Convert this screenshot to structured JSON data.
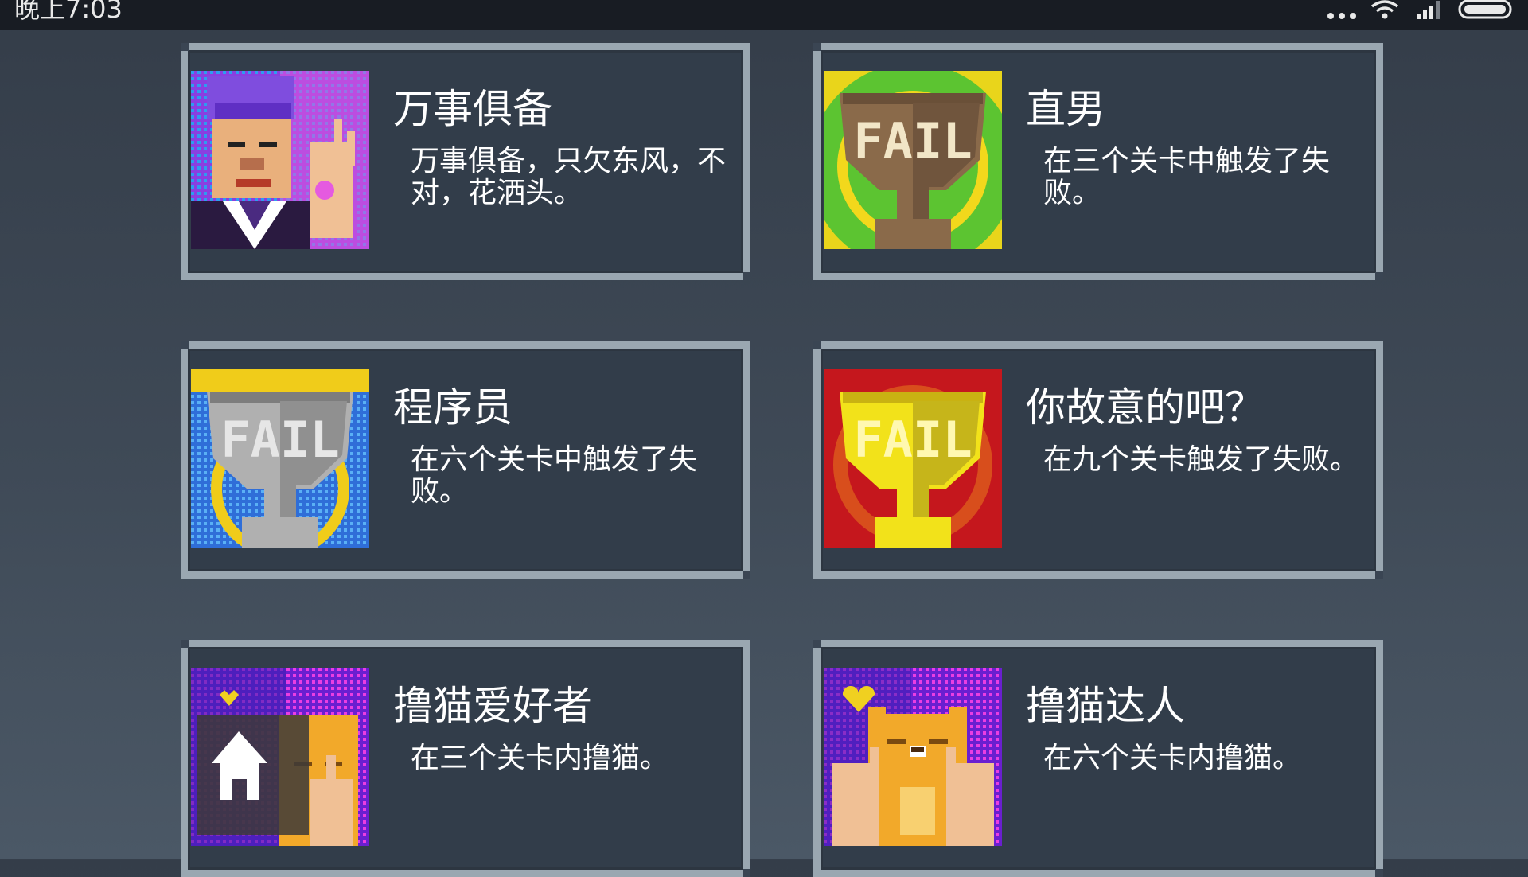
{
  "status_bar": {
    "time": "晚上7:03",
    "icons": [
      "more-dots-icon",
      "wifi-icon",
      "signal-icon",
      "battery-icon"
    ]
  },
  "achievements": [
    {
      "title": "万事俱备",
      "description": "万事俱备，只欠东风，不对，花洒头。",
      "image": "old-man-ok-gesture"
    },
    {
      "title": "直男",
      "description": "在三个关卡中触发了失败。",
      "image": "fail-trophy-bronze"
    },
    {
      "title": "程序员",
      "description": "在六个关卡中触发了失败。",
      "image": "fail-trophy-silver"
    },
    {
      "title": "你故意的吧？",
      "description": "在九个关卡触发了失败。",
      "image": "fail-trophy-gold"
    },
    {
      "title": "撸猫爱好者",
      "description": "在三个关卡内撸猫。",
      "image": "cat-petting-paw"
    },
    {
      "title": "撸猫达人",
      "description": "在六个关卡内撸猫。",
      "image": "cat-petting-hands"
    }
  ],
  "colors": {
    "card_border": "#9aa7b1",
    "card_bg": "#323d4a",
    "status_bar_bg": "#181c23",
    "trophy_bronze_bg": "#5cc431",
    "trophy_silver_bg": "#2f6ed8",
    "trophy_gold_bg": "#c5171d",
    "cat_bg": "#6a1fd0"
  }
}
